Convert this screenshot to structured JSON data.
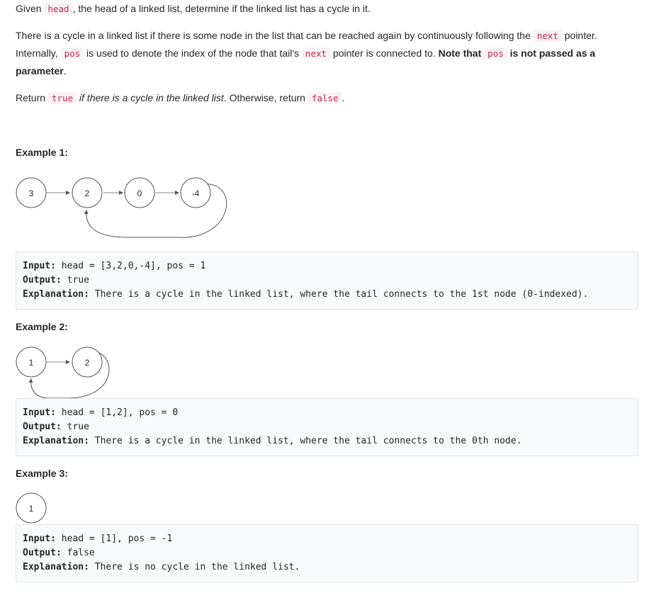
{
  "intro": {
    "p1": {
      "given": "Given",
      "head_code": "head",
      "rest": ", the head of a linked list, determine if the linked list has a cycle in it."
    },
    "p2": {
      "t1": "There is a cycle in a linked list if there is some node in the list that can be reached again by continuously following the",
      "next_code": "next",
      "t2": "pointer.",
      "t3": "Internally,",
      "pos_code": "pos",
      "t4": "is used to denote the index of the node that tail's",
      "next_code2": "next",
      "t5": "pointer is connected to.",
      "bold1": "Note that",
      "pos_code2": "pos",
      "bold2": "is not passed as a",
      "bold3": "parameter",
      "t6": "."
    },
    "p3": {
      "t1": "Return",
      "true_code": "true",
      "em": "if there is a cycle in the linked list",
      "t2": ". Otherwise, return",
      "false_code": "false",
      "t3": "."
    }
  },
  "examples": [
    {
      "title": "Example 1:",
      "nodes": [
        "3",
        "2",
        "0",
        "-4"
      ],
      "input_label": "Input:",
      "input_value": " head = [3,2,0,-4], pos = 1",
      "output_label": "Output:",
      "output_value": " true",
      "explanation_label": "Explanation:",
      "explanation_value": " There is a cycle in the linked list, where the tail connects to the 1st node (0-indexed)."
    },
    {
      "title": "Example 2:",
      "nodes": [
        "1",
        "2"
      ],
      "input_label": "Input:",
      "input_value": " head = [1,2], pos = 0",
      "output_label": "Output:",
      "output_value": " true",
      "explanation_label": "Explanation:",
      "explanation_value": " There is a cycle in the linked list, where the tail connects to the 0th node."
    },
    {
      "title": "Example 3:",
      "nodes": [
        "1"
      ],
      "input_label": "Input:",
      "input_value": " head = [1], pos = -1",
      "output_label": "Output:",
      "output_value": " false",
      "explanation_label": "Explanation:",
      "explanation_value": " There is no cycle in the linked list."
    }
  ]
}
